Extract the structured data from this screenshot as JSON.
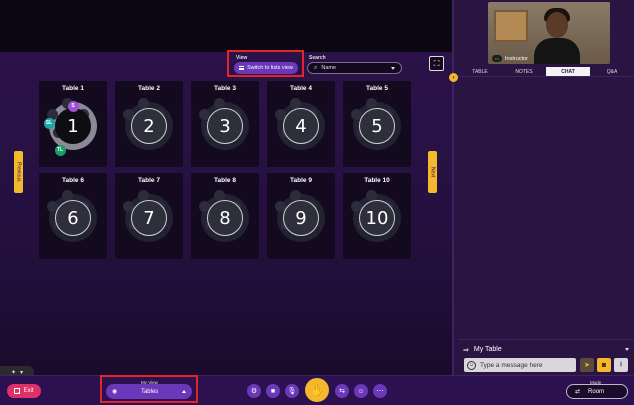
{
  "view": {
    "label": "View",
    "button": "Switch to lists view"
  },
  "search": {
    "label": "Search",
    "value": "Name"
  },
  "tables": [
    {
      "name": "Table 1",
      "number": "1"
    },
    {
      "name": "Table 2",
      "number": "2"
    },
    {
      "name": "Table 3",
      "number": "3"
    },
    {
      "name": "Table 4",
      "number": "4"
    },
    {
      "name": "Table 5",
      "number": "5"
    },
    {
      "name": "Table 6",
      "number": "6"
    },
    {
      "name": "Table 7",
      "number": "7"
    },
    {
      "name": "Table 8",
      "number": "8"
    },
    {
      "name": "Table 9",
      "number": "9"
    },
    {
      "name": "Table 10",
      "number": "10"
    }
  ],
  "table1_avatars": [
    {
      "initials": "S",
      "color": "#a24fd6"
    },
    {
      "initials": "SL",
      "color": "#1aa7a7"
    },
    {
      "initials": "TL",
      "color": "#1c9b6a"
    }
  ],
  "nav": {
    "previous": "Previous",
    "next": "Next"
  },
  "video": {
    "name": "Instructor"
  },
  "tabs": [
    {
      "label": "TABLE",
      "active": false
    },
    {
      "label": "NOTES",
      "active": false
    },
    {
      "label": "CHAT",
      "active": true
    },
    {
      "label": "Q&A",
      "active": false
    }
  ],
  "chat": {
    "scope": "My Table",
    "placeholder": "Type a message here"
  },
  "toolbar": {
    "exit": "Exit",
    "my_view_label": "My View",
    "my_view_value": "Tables",
    "mode_label": "Mode",
    "mode_value": "Room"
  },
  "colors": {
    "accent": "#6a38b8",
    "highlight": "#f3b82c",
    "exit": "#e0306a",
    "annotation": "#e0262b"
  }
}
